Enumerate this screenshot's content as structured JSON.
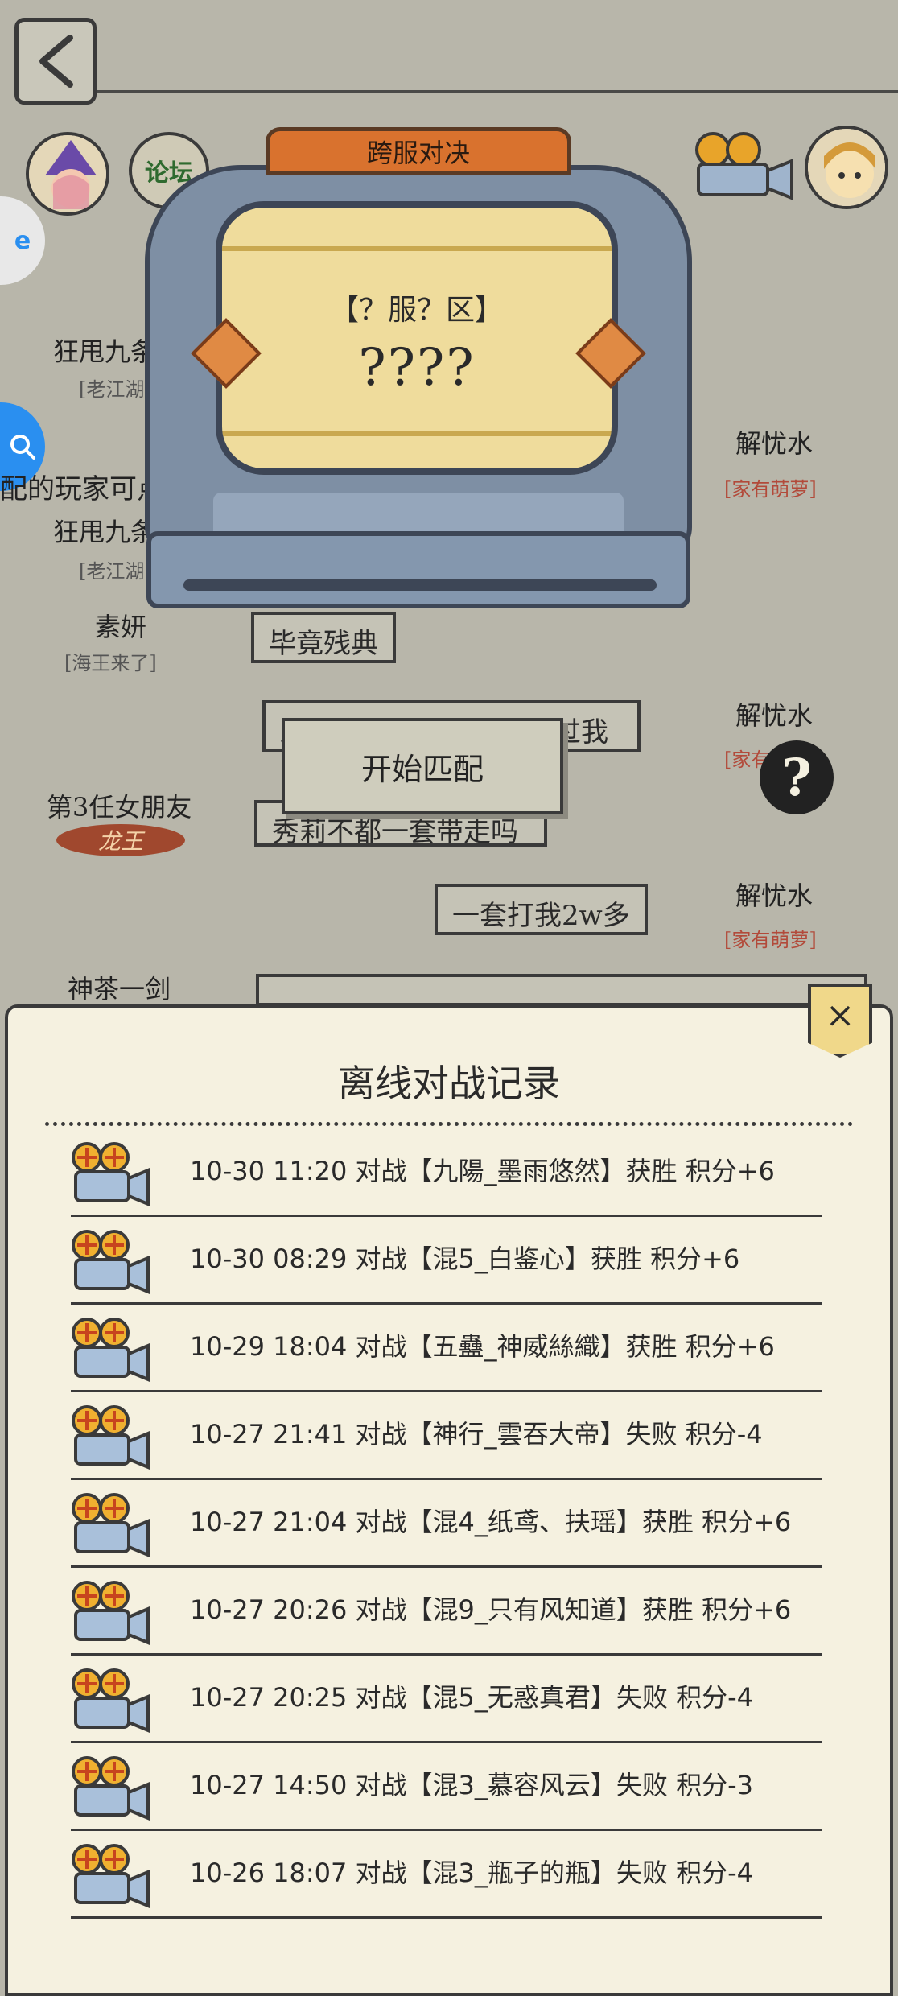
{
  "header": {
    "back_label": "‹",
    "forum_label": "论坛"
  },
  "battle_machine": {
    "title": "跨服对决",
    "server_label": "【？服？区】",
    "opponent": "????",
    "start_button": "开始匹配"
  },
  "hint_text": "配的玩家可点击进行挑战.",
  "left_players": [
    {
      "name": "狂甩九条",
      "tag": "[老江湖"
    },
    {
      "name": "狂甩九条",
      "tag": "[老江湖"
    },
    {
      "name": "素妍",
      "tag": "[海王来了]"
    },
    {
      "name": "第3任女朋友",
      "tag": "龙王"
    },
    {
      "name": "神茶一剑",
      "tag": ""
    }
  ],
  "right_players": [
    {
      "name": "解忧水",
      "tag": "[家有萌萝]"
    },
    {
      "name": "解忧水",
      "tag": "[家有萌萝]"
    },
    {
      "name": "解忧水",
      "tag": "[家有萌萝]"
    }
  ],
  "chat_bubbles": [
    "毕竟残典",
    "踢跟家伙该有香蕉没打过我",
    "秀莉不都一套带走吗",
    "一套打我2w多"
  ],
  "help_label": "?",
  "record_panel": {
    "title": "离线对战记录",
    "close_label": "×",
    "records": [
      "10-30  11:20  对战【九陽_墨雨悠然】获胜  积分+6",
      "10-30  08:29  对战【混5_白鉴心】获胜  积分+6",
      "10-29  18:04  对战【五蠱_神威絲織】获胜  积分+6",
      "10-27  21:41  对战【神行_雲吞大帝】失败  积分-4",
      "10-27  21:04  对战【混4_纸鸢、扶瑶】获胜  积分+6",
      "10-27  20:26  对战【混9_只有风知道】获胜  积分+6",
      "10-27  20:25  对战【混5_无惑真君】失败  积分-4",
      "10-27  14:50  对战【混3_慕容风云】失败  积分-3",
      "10-26  18:07  对战【混3_瓶子的瓶】失败  积分-4"
    ]
  },
  "colors": {
    "background": "#b8b6aa",
    "panel": "#f5f1e0",
    "machine_body": "#7e8fa4",
    "machine_tab": "#d9722e",
    "screen": "#efdc9c"
  }
}
